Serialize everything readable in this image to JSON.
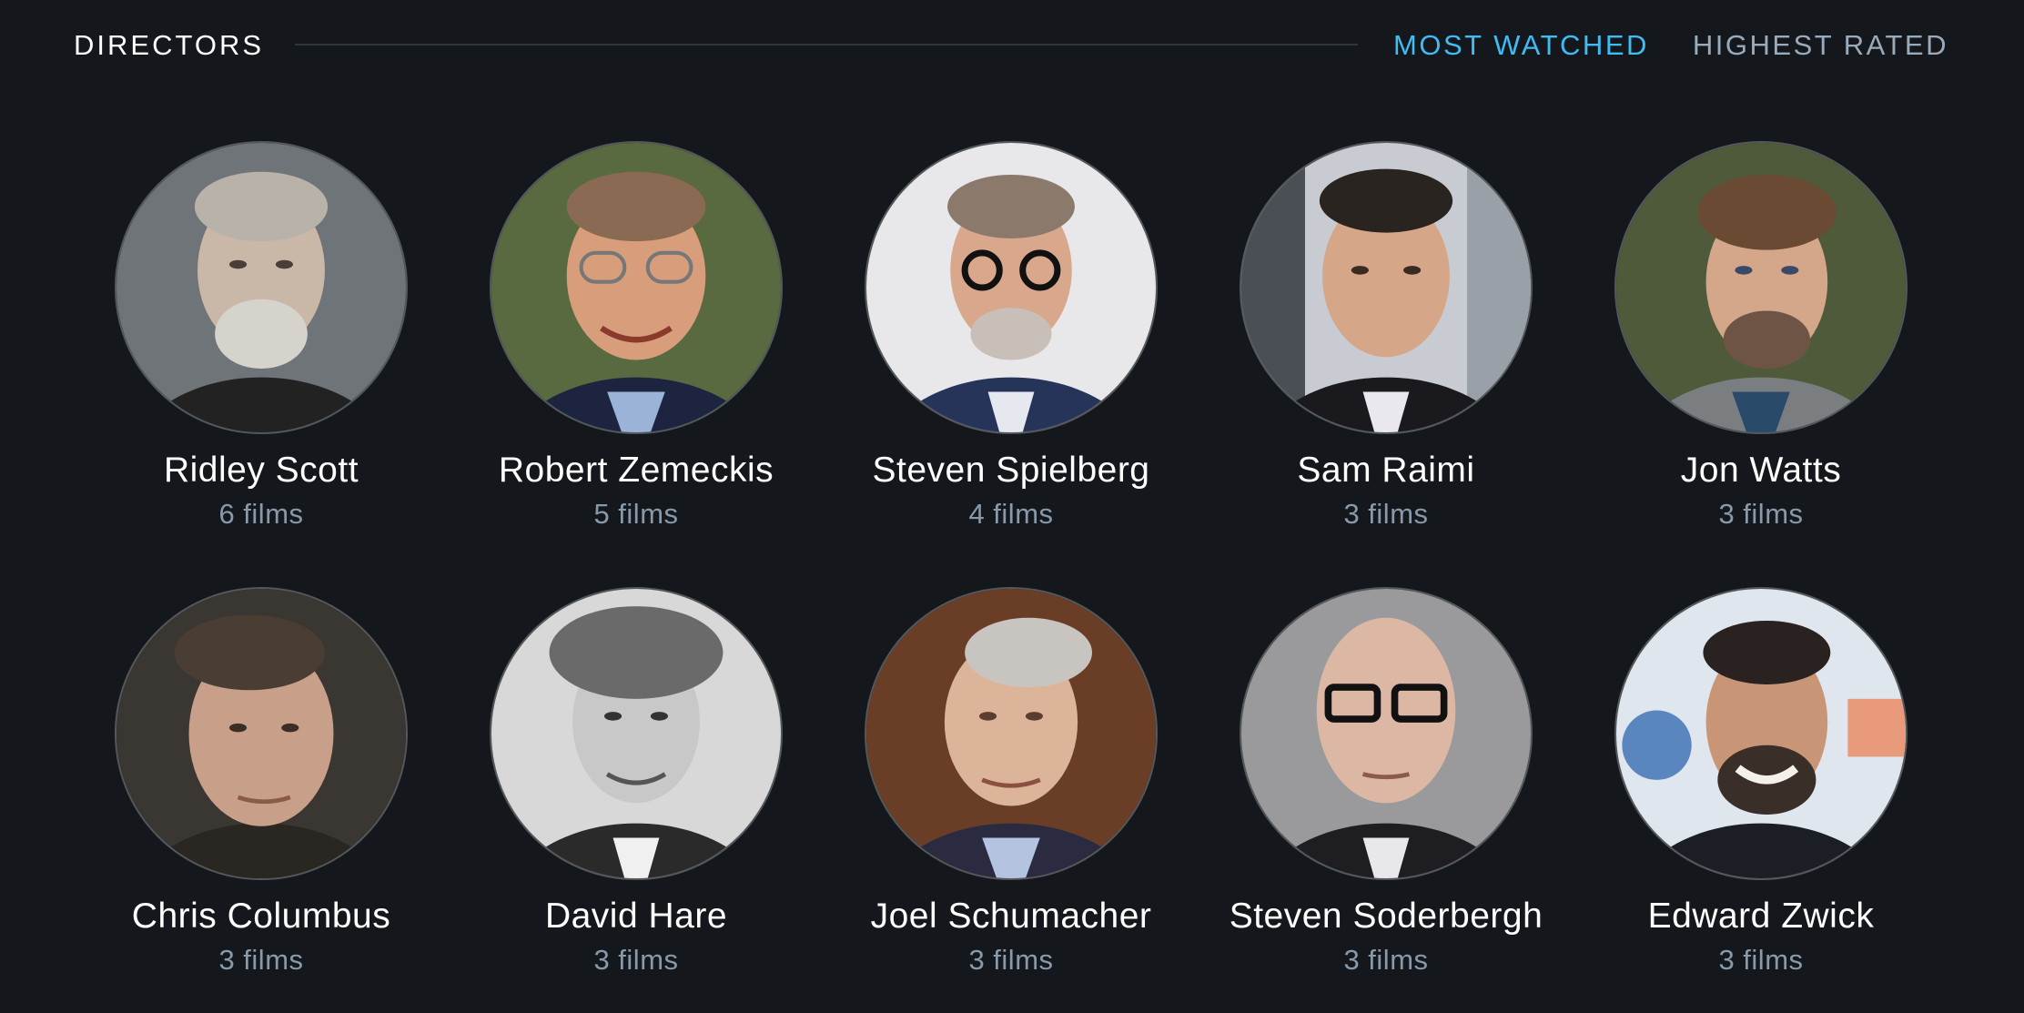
{
  "header": {
    "title": "DIRECTORS",
    "tabs": [
      {
        "label": "MOST WATCHED",
        "active": true
      },
      {
        "label": "HIGHEST RATED",
        "active": false
      }
    ]
  },
  "colors": {
    "background": "#14181c",
    "accent": "#40bcf4",
    "muted": "#8899aa"
  },
  "directors": [
    {
      "name": "Ridley Scott",
      "films": "6 films"
    },
    {
      "name": "Robert Zemeckis",
      "films": "5 films"
    },
    {
      "name": "Steven Spielberg",
      "films": "4 films"
    },
    {
      "name": "Sam Raimi",
      "films": "3 films"
    },
    {
      "name": "Jon Watts",
      "films": "3 films"
    },
    {
      "name": "Chris Columbus",
      "films": "3 films"
    },
    {
      "name": "David Hare",
      "films": "3 films"
    },
    {
      "name": "Joel Schumacher",
      "films": "3 films"
    },
    {
      "name": "Steven Soderbergh",
      "films": "3 films"
    },
    {
      "name": "Edward Zwick",
      "films": "3 films"
    }
  ]
}
